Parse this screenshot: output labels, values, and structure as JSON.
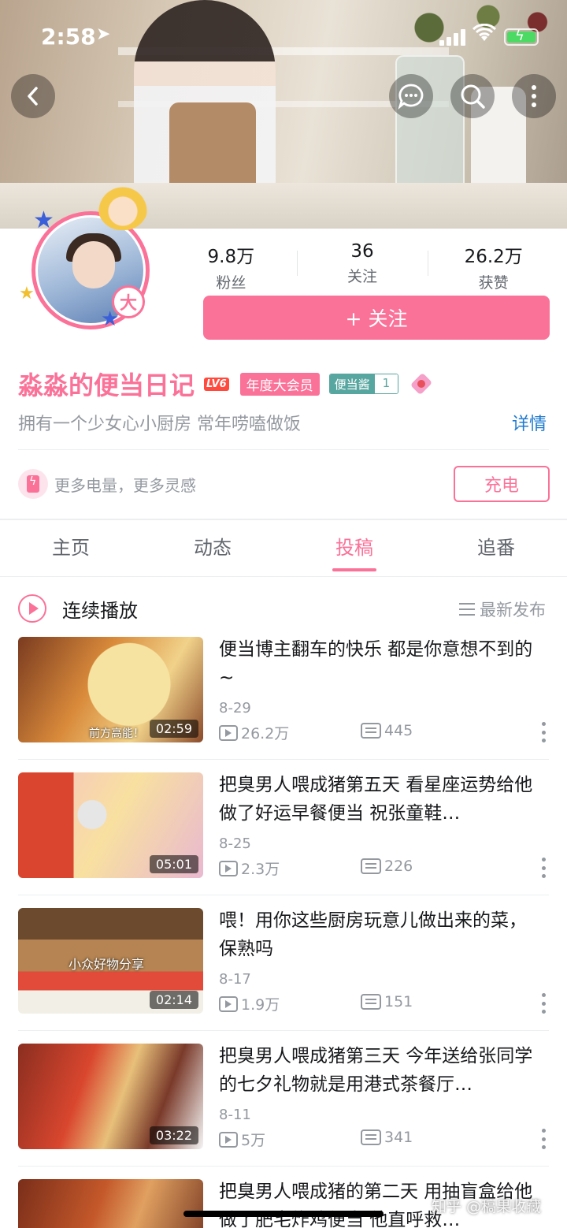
{
  "status_bar": {
    "time": "2:58",
    "location_icon": "navigation-arrow-icon",
    "signal_icon": "cellular-signal-icon",
    "wifi_icon": "wifi-icon",
    "battery_icon": "battery-charging-icon"
  },
  "header": {
    "back_icon": "chevron-left-icon",
    "message_icon": "chat-bubble-icon",
    "search_icon": "search-icon",
    "more_icon": "vertical-dots-icon"
  },
  "profile": {
    "avatar_badge": "大",
    "stats": [
      {
        "value": "9.8万",
        "label": "粉丝"
      },
      {
        "value": "36",
        "label": "关注"
      },
      {
        "value": "26.2万",
        "label": "获赞"
      }
    ],
    "follow_label": "+ 关注",
    "username": "淼淼的便当日记",
    "level_badge": "LV6",
    "vip_badge": "年度大会员",
    "fan_medal": {
      "name": "便当酱",
      "level": "1"
    },
    "bio": "拥有一个少女心小厨房  常年唠嗑做饭",
    "detail_link": "详情",
    "charge": {
      "text": "更多电量，更多灵感",
      "button": "充电"
    }
  },
  "tabs": [
    {
      "label": "主页",
      "active": false
    },
    {
      "label": "动态",
      "active": false
    },
    {
      "label": "投稿",
      "active": true
    },
    {
      "label": "追番",
      "active": false
    }
  ],
  "playlist": {
    "label": "连续播放",
    "sort_label": "最新发布"
  },
  "videos": [
    {
      "title": "便当博主翻车的快乐  都是你意想不到的~",
      "duration": "02:59",
      "date": "8-29",
      "views": "26.2万",
      "danmaku": "445",
      "overlay": "前方高能！"
    },
    {
      "title": "把臭男人喂成猪第五天  看星座运势给他做了好运早餐便当  祝张童鞋…",
      "duration": "05:01",
      "date": "8-25",
      "views": "2.3万",
      "danmaku": "226",
      "overlay": ""
    },
    {
      "title": "喂！用你这些厨房玩意儿做出来的菜，保熟吗",
      "duration": "02:14",
      "date": "8-17",
      "views": "1.9万",
      "danmaku": "151",
      "overlay": "小众好物分享"
    },
    {
      "title": "把臭男人喂成猪第三天  今年送给张同学的七夕礼物就是用港式茶餐厅…",
      "duration": "03:22",
      "date": "8-11",
      "views": "5万",
      "danmaku": "341",
      "overlay": ""
    },
    {
      "title": "把臭男人喂成猪的第二天  用抽盲盒给他做了肥宅炸鸡便当  他直呼救…",
      "duration": "",
      "date": "",
      "views": "",
      "danmaku": "",
      "overlay": ""
    }
  ],
  "watermark": "知乎 @稿果收藏",
  "colors": {
    "accent": "#fb7299",
    "link": "#1e7ad0",
    "muted": "#9499a0"
  }
}
